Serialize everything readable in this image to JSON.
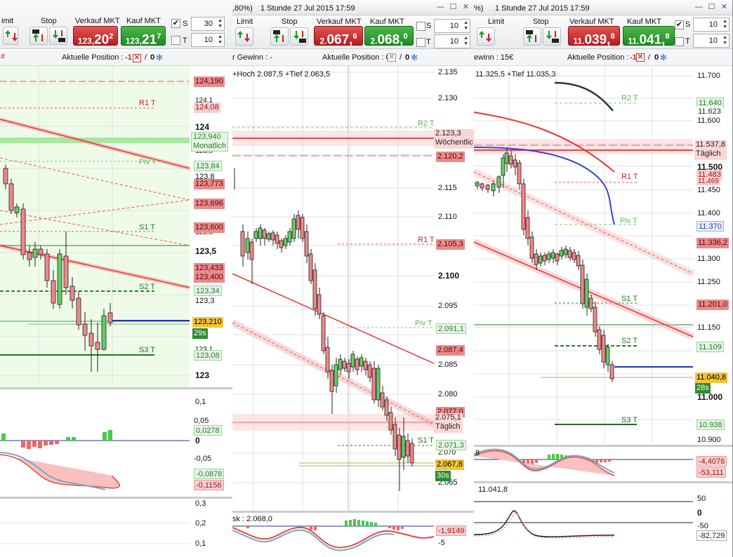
{
  "panel1": {
    "toolbar": {
      "limit": "imit",
      "stop": "Stop",
      "sell_label": "Verkauf MKT",
      "buy_label": "Kauf MKT",
      "sell_price_small": "123,",
      "sell_price_big": "20",
      "sell_price_sup": "2",
      "buy_price_small": "123,",
      "buy_price_big": "21",
      "buy_price_sup": "7",
      "s_label": "S",
      "t_label": "T",
      "s_value": "30",
      "t_value": "10",
      "s_checked": "✔"
    },
    "position": {
      "label": "Aktuelle Position :",
      "value": "-1",
      "slash": "/",
      "zero": "0"
    },
    "y_labels": [
      "124,1",
      "124",
      "123,9",
      "123,8",
      "123,7",
      "123,6",
      "123,5",
      "123,4",
      "123,3",
      "123,2",
      "123,1",
      "123"
    ],
    "tags": {
      "t124190": "124,190",
      "t12408": "124,08",
      "t123940": "123,940",
      "monatlich": "Monatlich",
      "t12384": "123,84",
      "t123773": "123,773",
      "t123696": "123,696",
      "t123600": "123,600",
      "t123433": "123,433",
      "t123400": "123,400",
      "t12334": "123,34",
      "t123210": "123,210",
      "countdown": "29s",
      "t12308": "123,08"
    },
    "levels": {
      "r1": "R1 T",
      "piv": "Piv T",
      "s1": "S1 T",
      "s2": "S2 T",
      "s3": "S3 T"
    },
    "ind1_labels": {
      "p01": "0,1",
      "p005": "0,05",
      "zero": "0",
      "m005": "-0,05"
    },
    "ind1_tags": {
      "a": "0,0278",
      "b": "-0,0878",
      "c": "-0,1156"
    },
    "ind2_labels": {
      "p03": "0,3",
      "p02": "0,2",
      "p01": "0,1"
    }
  },
  "panel2": {
    "title": {
      "left": ",80%)",
      "center": "1 Stunde  27 Jul 2015 17:59"
    },
    "toolbar": {
      "limit": "Limit",
      "stop": "Stop",
      "sell_label": "Verkauf MKT",
      "buy_label": "Kauf MKT",
      "sell_price_small": "2.",
      "sell_price_big": "067,",
      "sell_price_sup": "6",
      "buy_price_small": "2.",
      "buy_price_big": "068,",
      "buy_price_sup": "0",
      "s_label": "S",
      "t_label": "T",
      "s_value": "10",
      "t_value": "10"
    },
    "position": {
      "label": "Aktuelle Position : 0",
      "slash": "/",
      "zero": "0"
    },
    "gewinn": "r Gewinn : -",
    "hochtief": "+Hoch 2.087,5 +Tief 2.063,5",
    "y_labels": [
      "2.135",
      "2.130",
      "2.125",
      "2.120",
      "2.115",
      "2.110",
      "2.105",
      "2.100",
      "2.095",
      "2.090",
      "2.085",
      "2.080",
      "2.075",
      "2.070",
      "2.065"
    ],
    "tags": {
      "t2123": "2.123,3",
      "woechentlich": "Wöchentlic",
      "t21202": "2.120,2",
      "t21053": "2.105,3",
      "t20911": "2.091,1",
      "t20874": "2.087,4",
      "t2077": "2.077,0",
      "t20751": "2.075,1",
      "taeglich": "Täglich",
      "t20713": "2.071,3",
      "t20678": "2.067,8",
      "countdown": "30s"
    },
    "levels": {
      "r2": "R2 T",
      "r1": "R1 T",
      "piv": "Piv T",
      "s1": "S1 T"
    },
    "ind_label": "sk : 2.068,0",
    "ind_tags": {
      "a": "-1,9149",
      "b": "-5"
    }
  },
  "panel3": {
    "title": {
      "left": "%)",
      "center": "1 Stunde  27 Jul 2015 17:59"
    },
    "toolbar": {
      "limit": "Limit",
      "stop": "Stop",
      "sell_label": "Verkauf MKT",
      "buy_label": "Kauf MKT",
      "sell_price_small": "11.",
      "sell_price_big": "039,",
      "sell_price_sup": "8",
      "buy_price_small": "11.",
      "buy_price_big": "041,",
      "buy_price_sup": "8",
      "s_label": "S",
      "t_label": "T",
      "s_value": "10",
      "t_value": "10",
      "s_checked": "✔"
    },
    "position": {
      "label": "Aktuelle Position :",
      "value": "-1",
      "slash": "/",
      "zero": "0"
    },
    "gewinn": "ewinn : 15€",
    "hochtief": "11.325,5 +Tief 11.035,3",
    "y_labels": [
      "11.700",
      "11.650",
      "11.600",
      "11.550",
      "11.500",
      "11.450",
      "11.400",
      "11.350",
      "11.300",
      "11.250",
      "11.200",
      "11.150",
      "11.100",
      "11.050",
      "11.000",
      "10.950",
      "10.900"
    ],
    "tags": {
      "t11640": "11.640",
      "t11623": "11.623",
      "t115378": "11.537,8",
      "taeglich": "Täglich",
      "t11483": "11.483",
      "t11469": "11.469",
      "t11370": "11.370",
      "t113362": "11.336,2",
      "t112010": "11.201,0",
      "t11109": "11.109",
      "t110408": "11.040,8",
      "countdown": "28s",
      "t10938": "10.938"
    },
    "levels": {
      "r2": "R2 T",
      "r1": "R1 T",
      "piv": "Piv T",
      "s1": "S1 T",
      "s2": "S2 T",
      "s3": "S3 T"
    },
    "ind1_label": "8",
    "ind1_tags": {
      "a": "-4,4076",
      "b": "-53,111"
    },
    "ind2_label": "11.041,8",
    "ind2_labels": {
      "p50": "50",
      "zero": "0",
      "m50": "-50"
    },
    "ind2_tags": {
      "a": "-82,729"
    }
  }
}
